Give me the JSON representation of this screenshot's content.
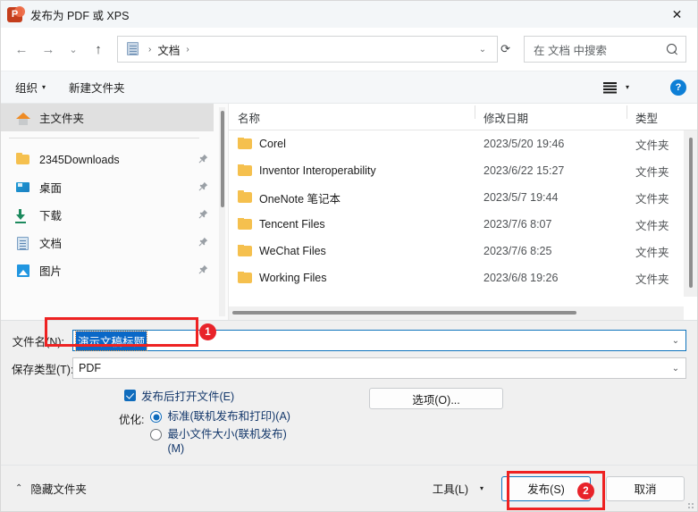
{
  "window": {
    "title": "发布为 PDF 或 XPS",
    "app_icon": "powerpoint-icon",
    "close_label": "✕"
  },
  "nav": {
    "back": "←",
    "forward": "→",
    "recent": "⌄",
    "up": "↑",
    "breadcrumb": {
      "icon": "documents-icon",
      "sep1": "›",
      "folder": "文档",
      "sep2": "›"
    },
    "address_chevron": "⌄",
    "refresh": "⟳",
    "search": {
      "placeholder": "在 文档 中搜索",
      "icon": "search-icon"
    }
  },
  "commandbar": {
    "organize": "组织",
    "organize_caret": "▾",
    "new_folder": "新建文件夹",
    "view_caret": "▾",
    "help": "?"
  },
  "sidebar": {
    "home": {
      "label": "主文件夹",
      "icon": "home-icon",
      "selected": true
    },
    "items": [
      {
        "label": "2345Downloads",
        "icon": "folder-icon",
        "pinned": true
      },
      {
        "label": "桌面",
        "icon": "desktop-icon",
        "pinned": true
      },
      {
        "label": "下载",
        "icon": "download-icon",
        "pinned": true
      },
      {
        "label": "文档",
        "icon": "documents-icon",
        "pinned": true
      },
      {
        "label": "图片",
        "icon": "pictures-icon",
        "pinned": true
      }
    ],
    "pin_glyph": "📌"
  },
  "filelist": {
    "sort_indicator": "⌃",
    "columns": [
      "名称",
      "修改日期",
      "类型"
    ],
    "rows": [
      {
        "name": "Corel",
        "date": "2023/5/20 19:46",
        "type": "文件夹"
      },
      {
        "name": "Inventor Interoperability",
        "date": "2023/6/22 15:27",
        "type": "文件夹"
      },
      {
        "name": "OneNote 笔记本",
        "date": "2023/5/7 19:44",
        "type": "文件夹"
      },
      {
        "name": "Tencent Files",
        "date": "2023/7/6 8:07",
        "type": "文件夹"
      },
      {
        "name": "WeChat Files",
        "date": "2023/7/6 8:25",
        "type": "文件夹"
      },
      {
        "name": "Working Files",
        "date": "2023/6/8 19:26",
        "type": "文件夹"
      }
    ]
  },
  "form": {
    "filename_label": "文件名(N):",
    "filename_value": "演示文稿标题",
    "filetype_label": "保存类型(T):",
    "filetype_value": "PDF",
    "dropdown_glyph": "⌄",
    "open_after_publish": "发布后打开文件(E)",
    "optimize_label": "优化:",
    "optimize_standard": "标准(联机发布和打印)(A)",
    "optimize_minimum": "最小文件大小(联机发布)(M)",
    "options_button": "选项(O)..."
  },
  "footer": {
    "hide_folders": "隐藏文件夹",
    "hide_chevron": "⌃",
    "tools": "工具(L)",
    "tools_caret": "▾",
    "publish": "发布(S)",
    "cancel": "取消"
  },
  "annotations": {
    "badge_one": "1",
    "badge_two": "2",
    "color": "#ee2222"
  }
}
